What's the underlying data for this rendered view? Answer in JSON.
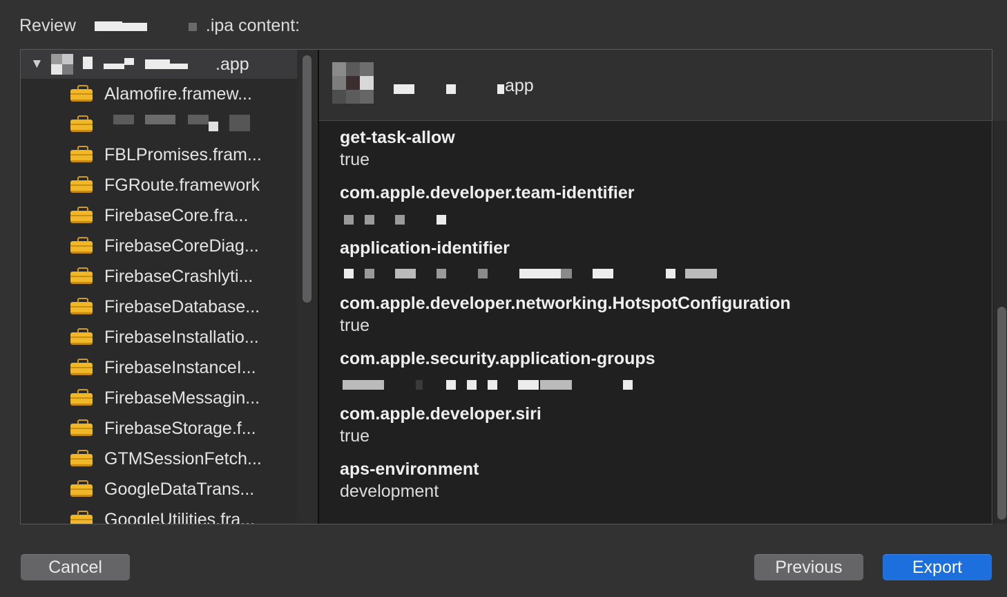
{
  "window": {
    "title_prefix": "Review",
    "title_suffix": ".ipa content:"
  },
  "sidebar": {
    "root_label": ".app",
    "items": [
      {
        "label": "Alamofire.framew...",
        "icon": "briefcase-icon"
      },
      {
        "label": "",
        "icon": "briefcase-icon"
      },
      {
        "label": "FBLPromises.fram...",
        "icon": "briefcase-icon"
      },
      {
        "label": "FGRoute.framework",
        "icon": "briefcase-icon"
      },
      {
        "label": "FirebaseCore.fra...",
        "icon": "briefcase-icon"
      },
      {
        "label": "FirebaseCoreDiag...",
        "icon": "briefcase-icon"
      },
      {
        "label": "FirebaseCrashlyti...",
        "icon": "briefcase-icon"
      },
      {
        "label": "FirebaseDatabase...",
        "icon": "briefcase-icon"
      },
      {
        "label": "FirebaseInstallatio...",
        "icon": "briefcase-icon"
      },
      {
        "label": "FirebaseInstanceI...",
        "icon": "briefcase-icon"
      },
      {
        "label": "FirebaseMessagin...",
        "icon": "briefcase-icon"
      },
      {
        "label": "FirebaseStorage.f...",
        "icon": "briefcase-icon"
      },
      {
        "label": "GTMSessionFetch...",
        "icon": "briefcase-icon"
      },
      {
        "label": "GoogleDataTrans...",
        "icon": "briefcase-icon"
      },
      {
        "label": "GoogleUtilities.fra...",
        "icon": "briefcase-icon"
      }
    ]
  },
  "detail": {
    "app_name": ".app",
    "entitlements": [
      {
        "key": "get-task-allow",
        "value": "true"
      },
      {
        "key": "com.apple.developer.team-identifier",
        "value": ""
      },
      {
        "key": "application-identifier",
        "value": ""
      },
      {
        "key": "com.apple.developer.networking.HotspotConfiguration",
        "value": "true"
      },
      {
        "key": "com.apple.security.application-groups",
        "value": ""
      },
      {
        "key": "com.apple.developer.siri",
        "value": "true"
      },
      {
        "key": "aps-environment",
        "value": "development"
      }
    ]
  },
  "buttons": {
    "cancel": "Cancel",
    "previous": "Previous",
    "export": "Export"
  },
  "colors": {
    "background": "#323233",
    "accent": "#1d6fdd",
    "briefcase": "#f0b826"
  }
}
